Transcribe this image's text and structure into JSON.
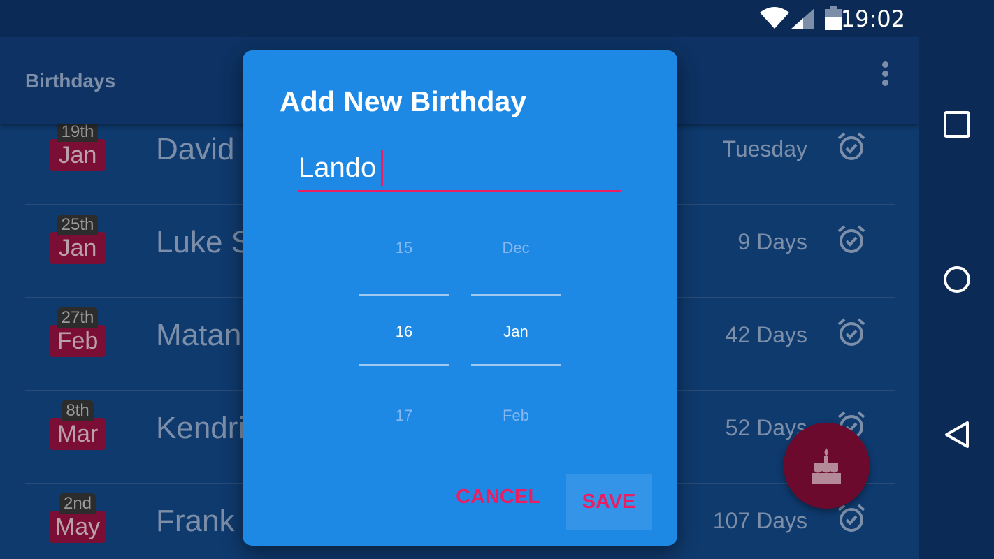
{
  "status_bar": {
    "time": "19:02"
  },
  "toolbar": {
    "title": "Birthdays"
  },
  "birthdays": [
    {
      "day": "19th",
      "month": "Jan",
      "name": "David I",
      "when": "Tuesday"
    },
    {
      "day": "25th",
      "month": "Jan",
      "name": "Luke S",
      "when": "9 Days"
    },
    {
      "day": "27th",
      "month": "Feb",
      "name": "Matan",
      "when": "42 Days"
    },
    {
      "day": "8th",
      "month": "Mar",
      "name": "Kendri",
      "when": "52 Days"
    },
    {
      "day": "2nd",
      "month": "May",
      "name": "Frank I",
      "when": "107 Days"
    }
  ],
  "dialog": {
    "title": "Add New Birthday",
    "name_value": "Lando",
    "day_picker": {
      "prev": "15",
      "current": "16",
      "next": "17"
    },
    "month_picker": {
      "prev": "Dec",
      "current": "Jan",
      "next": "Feb"
    },
    "cancel_label": "CANCEL",
    "save_label": "SAVE"
  },
  "colors": {
    "accent": "#e91e63",
    "dialog": "#1e88e5",
    "badge_month": "#7b0e35",
    "fab": "#6b0a2c"
  },
  "icons": [
    "wifi-icon",
    "signal-icon",
    "battery-icon",
    "more-vert-icon",
    "alarm-check-icon",
    "cake-icon",
    "recents-icon",
    "home-icon",
    "back-icon"
  ]
}
